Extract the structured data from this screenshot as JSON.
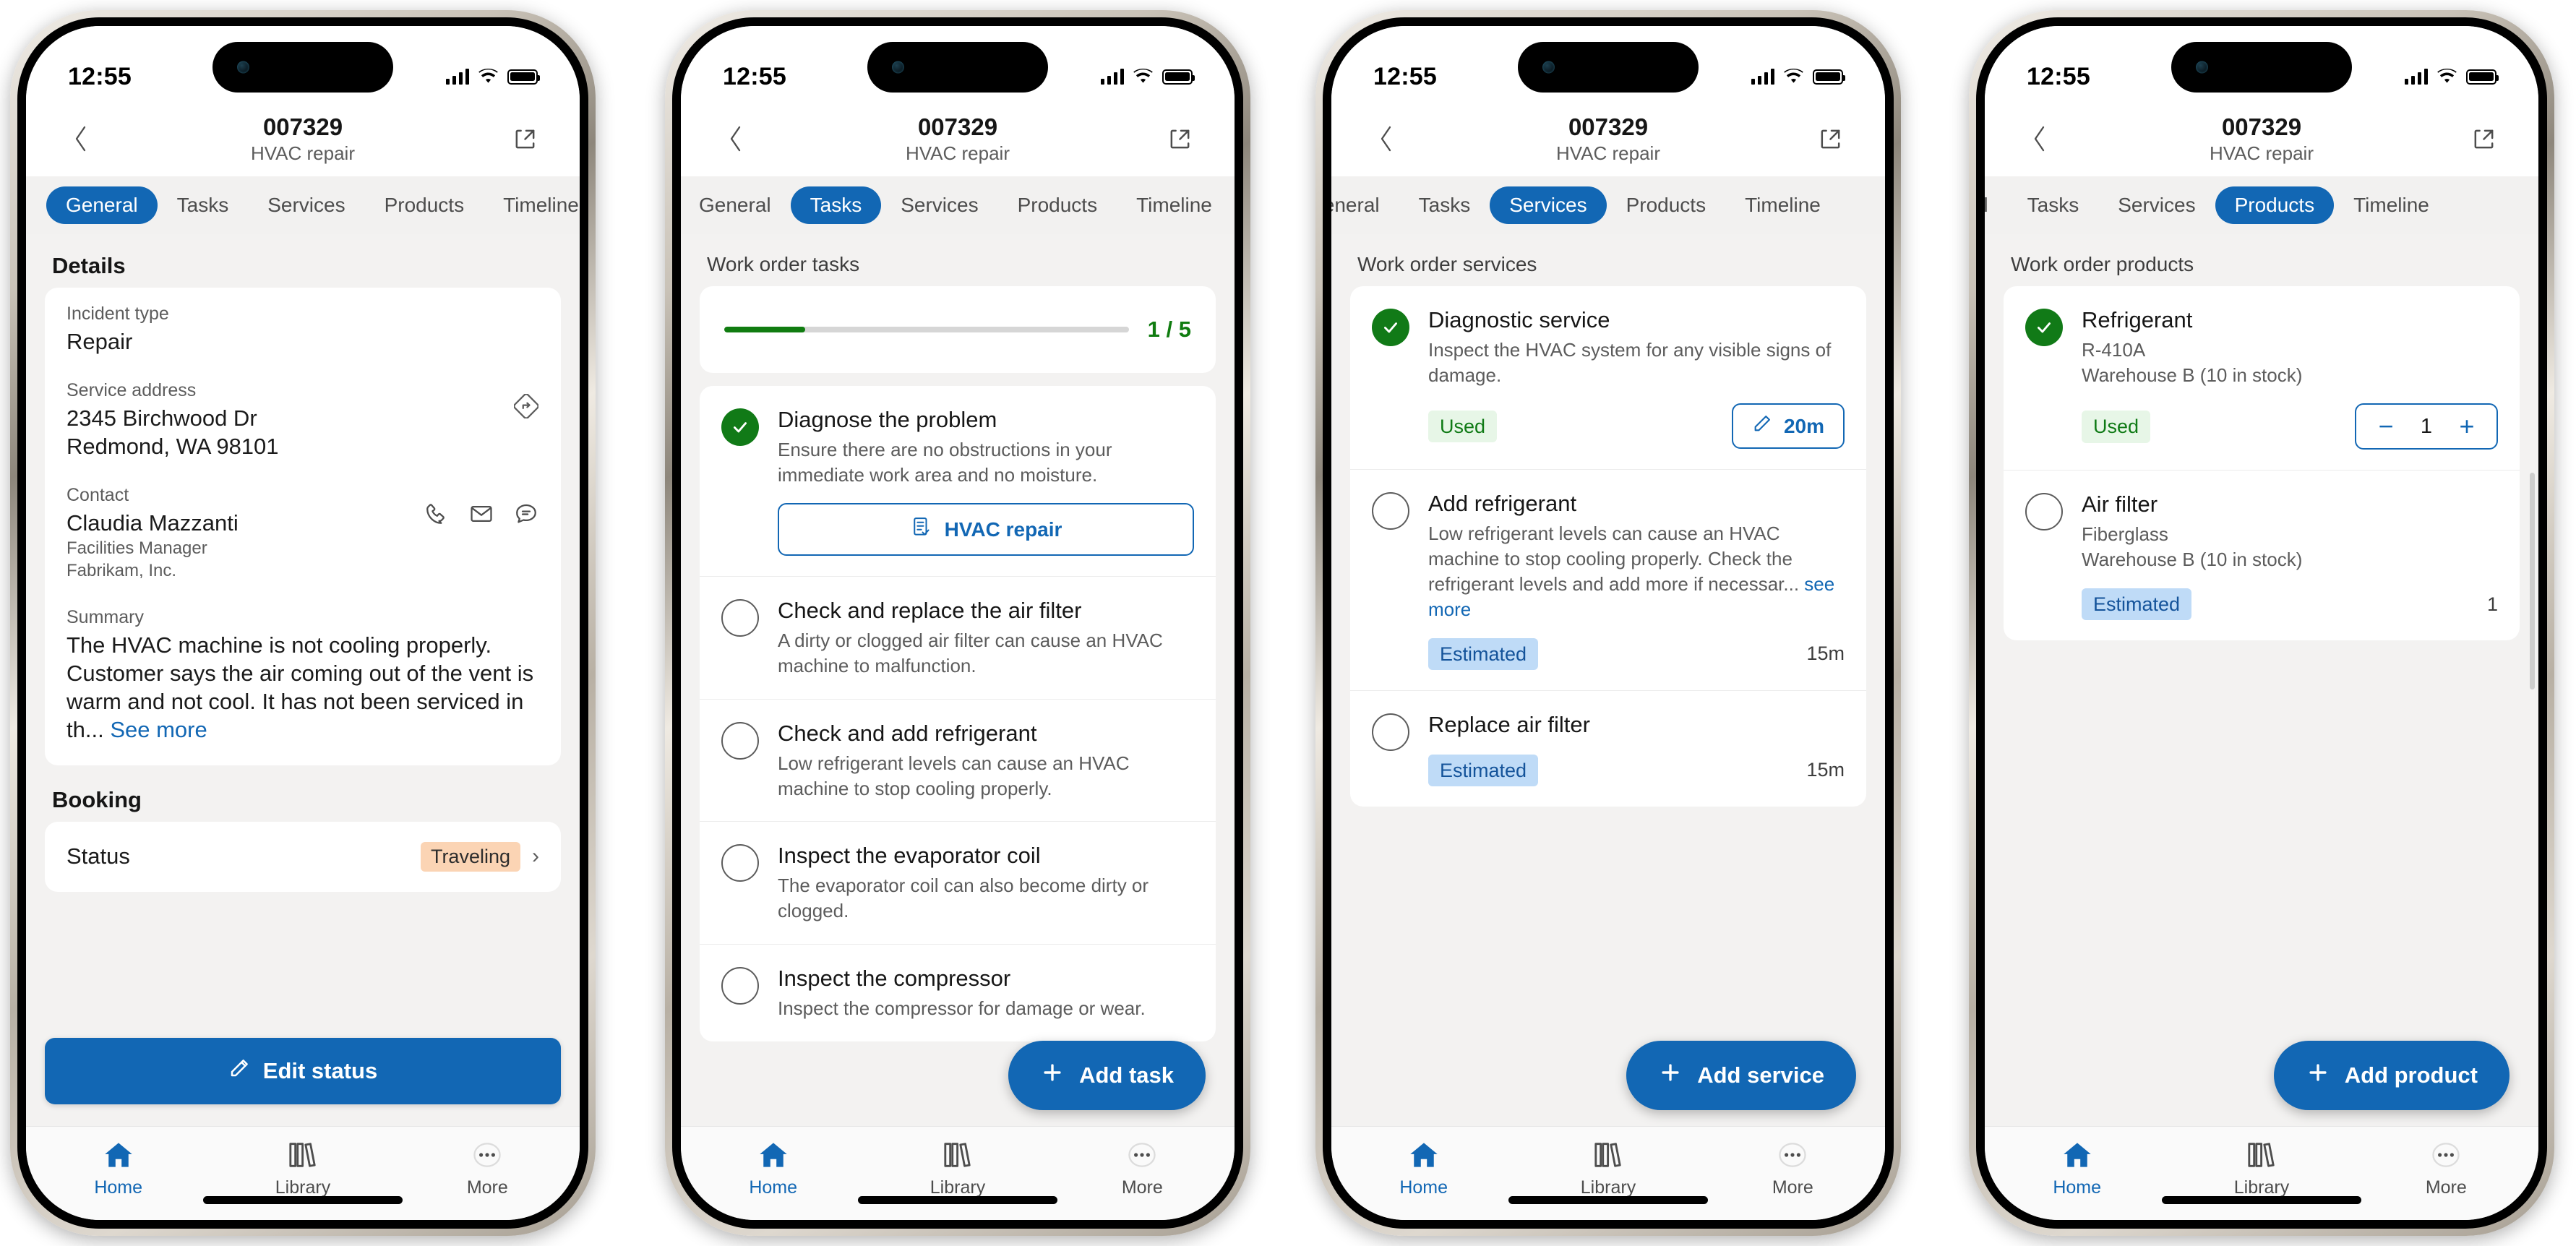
{
  "status_bar": {
    "time": "12:55",
    "signal_icon": "cellular-signal-icon",
    "wifi_icon": "wifi-icon",
    "battery_icon": "battery-icon"
  },
  "header": {
    "title": "007329",
    "subtitle": "HVAC repair",
    "back_icon": "chevron-left-icon",
    "share_icon": "open-in-new-icon"
  },
  "tabs": [
    {
      "label": "General"
    },
    {
      "label": "Tasks"
    },
    {
      "label": "Services"
    },
    {
      "label": "Products"
    },
    {
      "label": "Timeline"
    }
  ],
  "bottom_nav": [
    {
      "label": "Home",
      "icon": "home-icon"
    },
    {
      "label": "Library",
      "icon": "library-books-icon"
    },
    {
      "label": "More",
      "icon": "more-ellipsis-icon"
    }
  ],
  "accent_color": "#1267b4",
  "success_color": "#117a17",
  "phone1": {
    "active_tab": "General",
    "details_heading": "Details",
    "fields": {
      "incident_type_label": "Incident type",
      "incident_type_value": "Repair",
      "service_address_label": "Service address",
      "service_address_line1": "2345 Birchwood Dr",
      "service_address_line2": "Redmond, WA 98101",
      "directions_icon": "directions-icon",
      "contact_label": "Contact",
      "contact_name": "Claudia Mazzanti",
      "contact_role": "Facilities Manager",
      "contact_company": "Fabrikam, Inc.",
      "call_icon": "phone-icon",
      "email_icon": "mail-icon",
      "message_icon": "chat-icon",
      "summary_label": "Summary",
      "summary_text": "The HVAC machine is not cooling properly. Customer says the air coming out of the vent is warm and not cool. It has not been serviced in th...",
      "summary_more": "See more"
    },
    "booking_heading": "Booking",
    "booking_status_label": "Status",
    "booking_status_value": "Traveling",
    "edit_status_button": "Edit status",
    "edit_icon": "pencil-icon"
  },
  "phone2": {
    "active_tab": "Tasks",
    "section_label": "Work order tasks",
    "progress": {
      "completed": 1,
      "total": 5,
      "text": "1 / 5",
      "percent": 20
    },
    "tasks": [
      {
        "title": "Diagnose the problem",
        "desc": "Ensure there are no obstructions in your immediate work area and no moisture.",
        "done": true,
        "chip_label": "HVAC repair",
        "chip_icon": "checklist-icon"
      },
      {
        "title": "Check and replace the air filter",
        "desc": "A dirty or clogged air filter can cause an HVAC machine to malfunction.",
        "done": false
      },
      {
        "title": "Check and add refrigerant",
        "desc": "Low refrigerant levels can cause an HVAC machine to stop cooling properly.",
        "done": false
      },
      {
        "title": "Inspect the evaporator coil",
        "desc": "The evaporator coil can also become dirty or clogged.",
        "done": false
      },
      {
        "title": "Inspect the compressor",
        "desc": "Inspect the compressor for damage or wear.",
        "done": false
      }
    ],
    "fab_label": "Add task",
    "fab_icon": "plus-icon"
  },
  "phone3": {
    "active_tab": "Services",
    "section_label": "Work order services",
    "services": [
      {
        "title": "Diagnostic service",
        "desc": "Inspect the HVAC system for any visible signs of damage.",
        "done": true,
        "tag": "Used",
        "tag_kind": "used",
        "duration": "20m",
        "duration_editable": true,
        "edit_icon": "pencil-icon"
      },
      {
        "title": "Add refrigerant",
        "desc": "Low refrigerant levels can cause an HVAC machine to stop cooling properly. Check the refrigerant levels and add more if necessar...",
        "desc_more": "see more",
        "done": false,
        "tag": "Estimated",
        "tag_kind": "estimated",
        "duration": "15m",
        "duration_editable": false
      },
      {
        "title": "Replace air filter",
        "desc": "",
        "done": false,
        "tag": "Estimated",
        "tag_kind": "estimated",
        "duration": "15m",
        "duration_editable": false
      }
    ],
    "fab_label": "Add service",
    "fab_icon": "plus-icon"
  },
  "phone4": {
    "active_tab": "Products",
    "section_label": "Work order products",
    "products": [
      {
        "title": "Refrigerant",
        "sub1": "R-410A",
        "sub2": "Warehouse B (10 in stock)",
        "done": true,
        "tag": "Used",
        "tag_kind": "used",
        "quantity": "1",
        "stepper": true,
        "minus_label": "−",
        "plus_label": "+"
      },
      {
        "title": "Air filter",
        "sub1": "Fiberglass",
        "sub2": "Warehouse B (10 in stock)",
        "done": false,
        "tag": "Estimated",
        "tag_kind": "estimated",
        "quantity": "1",
        "stepper": false
      }
    ],
    "fab_label": "Add product",
    "fab_icon": "plus-icon"
  }
}
